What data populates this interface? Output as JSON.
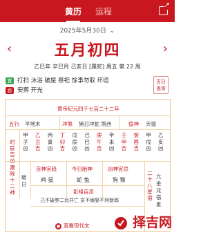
{
  "header": {
    "tab_active": "黄历",
    "tab_other": "运程"
  },
  "date": {
    "solar": "2025年5月30日",
    "chevron": "⌄"
  },
  "nav": {
    "prev": "‹",
    "next": "›"
  },
  "lunar": {
    "title": "五月初四",
    "ganzhi": "乙巳年 辛巳月 己亥日 [属蛇] 周五  第 22 周"
  },
  "yi": {
    "badge": "宜",
    "text": "打扫 沐浴 破屋 祭祀 馀事勿取 坏垣"
  },
  "ji": {
    "badge": "忌",
    "text": "安葬 开光"
  },
  "jiri_button": {
    "line1": "吉日",
    "line2": "查询"
  },
  "panel": {
    "era": "黄帝纪元四千七百二十二年",
    "wuxing_label": "五行",
    "wuxing_value": "平地木",
    "chongsha_label": "冲煞",
    "chongsha_value": "猪日冲蛇 煞西",
    "zhishen_label": "值神",
    "zhishen_value": "天德",
    "shichen_label": "时辰吉凶",
    "hours": [
      {
        "gan": "甲",
        "zhi": "子",
        "luck": "凶"
      },
      {
        "gan": "乙",
        "zhi": "丑",
        "luck": "吉"
      },
      {
        "gan": "丙",
        "zhi": "寅",
        "luck": "凶"
      },
      {
        "gan": "丁",
        "zhi": "卯",
        "luck": "吉"
      },
      {
        "gan": "戊",
        "zhi": "辰",
        "luck": "凶"
      },
      {
        "gan": "己",
        "zhi": "巳",
        "luck": "凶"
      },
      {
        "gan": "庚",
        "zhi": "午",
        "luck": "吉"
      },
      {
        "gan": "辛",
        "zhi": "未",
        "luck": "凶"
      },
      {
        "gan": "壬",
        "zhi": "申",
        "luck": "吉"
      },
      {
        "gan": "癸",
        "zhi": "酉",
        "luck": "吉"
      },
      {
        "gan": "甲",
        "zhi": "戌",
        "luck": "凶"
      },
      {
        "gan": "乙",
        "zhi": "亥",
        "luck": "凶"
      }
    ],
    "jianchu_label": "建除十二神",
    "jianchu_value": "破日",
    "jishen_label": "吉神宜趋",
    "jishen_value": "鸡 鼠",
    "taishen_label": "今日胎神",
    "taishen_value": "蛇 兔",
    "xiongshen_label": "凶神宜忌",
    "xiongshen_value": "狗 猴",
    "xiu_label": "二十八星宿",
    "xiu_value": "亢金龙宿星",
    "pengzu_label": "彭祖百忌",
    "pengzu_value": "己不破券二比并亡 亥不嫁娶不利新郎",
    "view_more": "查看现代文"
  },
  "watermark": "择吉网",
  "colors": {
    "brand": "#c8171e",
    "yi": "#3aa655",
    "ji": "#c8171e",
    "border": "#f0c28a"
  }
}
